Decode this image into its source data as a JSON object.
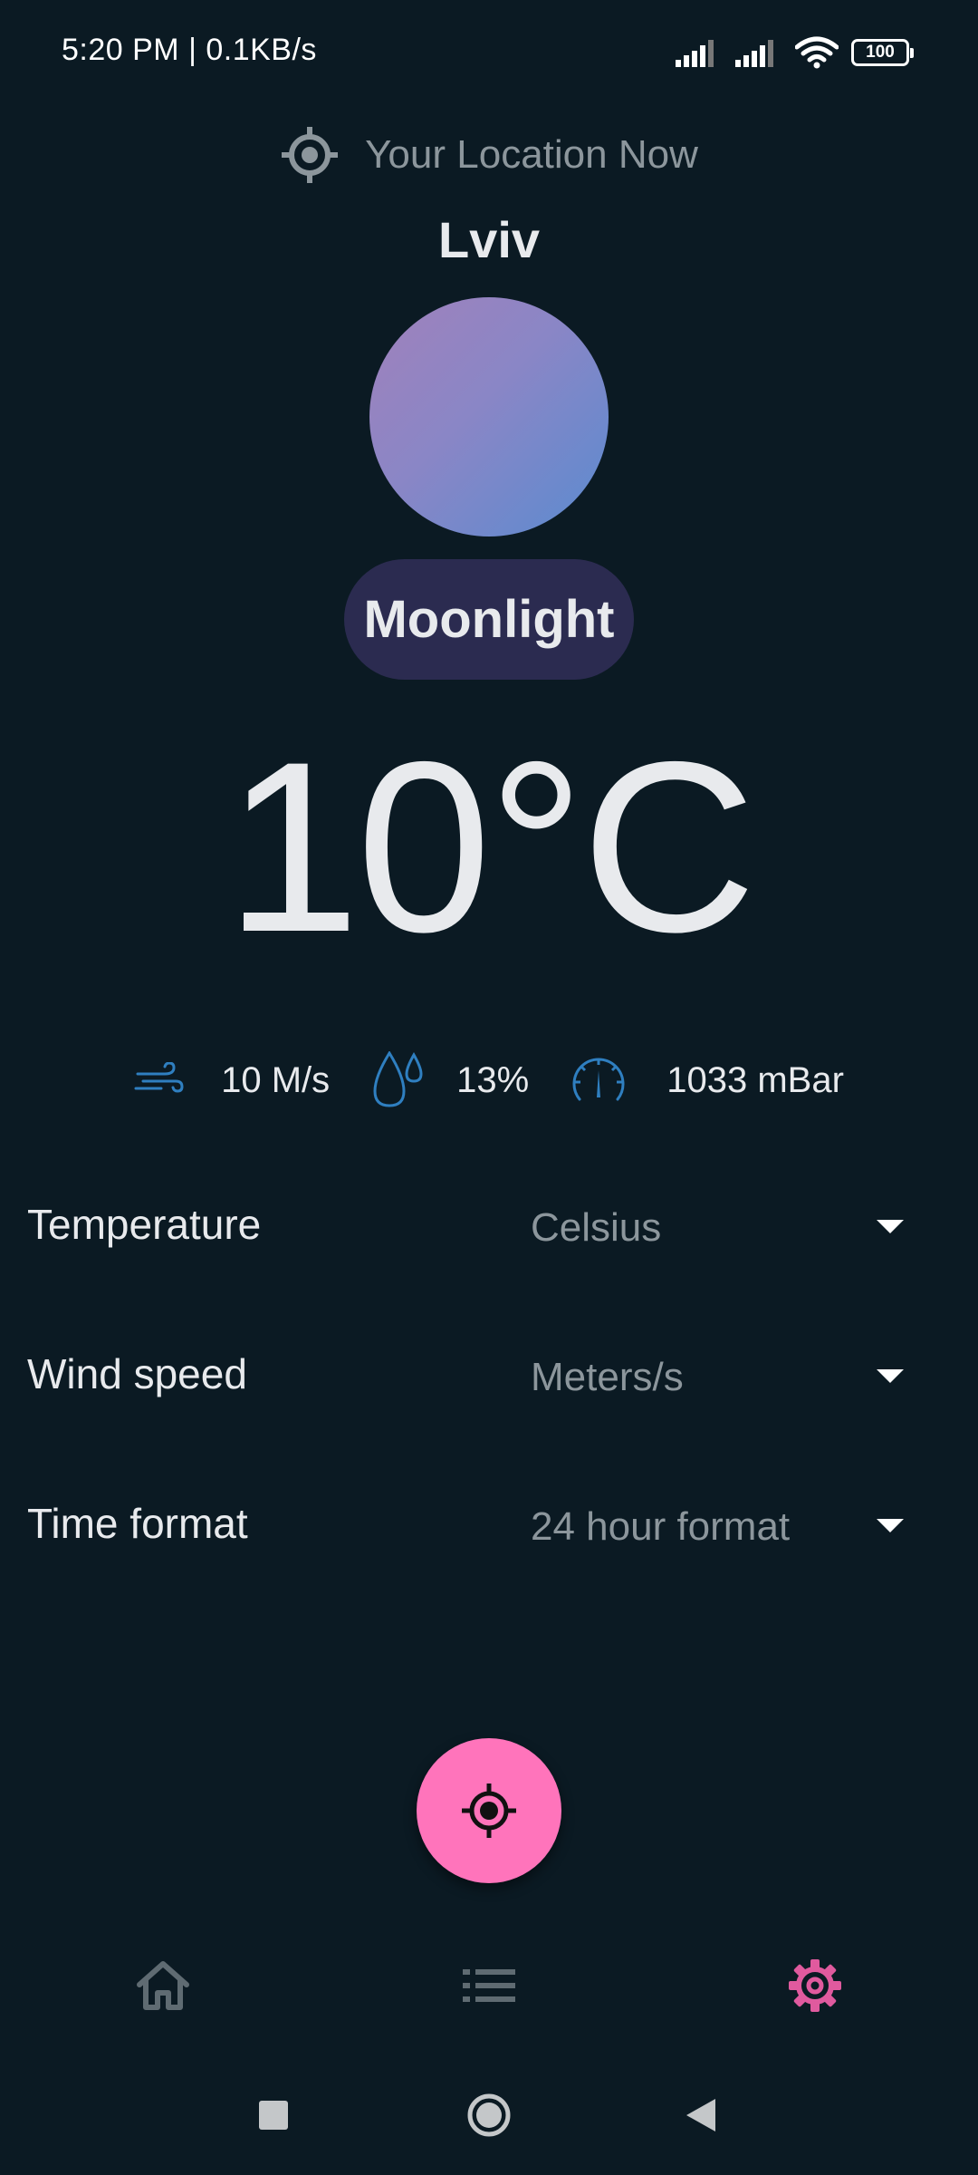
{
  "status_bar": {
    "time_speed": "5:20 PM | 0.1KB/s",
    "battery": "100",
    "icons": [
      "signal-icon",
      "signal-icon",
      "wifi-icon",
      "battery-icon"
    ]
  },
  "location": {
    "label": "Your Location Now",
    "icon": "crosshair-icon",
    "city": "Lviv"
  },
  "weather": {
    "condition": "Moonlight",
    "temperature": "10°C",
    "wind": "10 M/s",
    "humidity": "13%",
    "pressure": "1033 mBar",
    "moon_gradient": [
      "#a181bb",
      "#5a8bd0"
    ]
  },
  "settings": [
    {
      "label": "Temperature",
      "value": "Celsius"
    },
    {
      "label": "Wind speed",
      "value": "Meters/s"
    },
    {
      "label": "Time format",
      "value": "24 hour format"
    }
  ],
  "fab": {
    "icon": "my-location-icon",
    "color": "#ff74bb"
  },
  "bottom_nav": [
    {
      "name": "home",
      "icon": "home-icon",
      "active": false
    },
    {
      "name": "list",
      "icon": "list-icon",
      "active": false
    },
    {
      "name": "settings",
      "icon": "gear-icon",
      "active": true
    }
  ],
  "colors": {
    "background": "#0b1a23",
    "accent": "#ff74bb",
    "icon_blue": "#2f7fc0",
    "muted": "#8c969c",
    "pill": "#2b2b50"
  }
}
